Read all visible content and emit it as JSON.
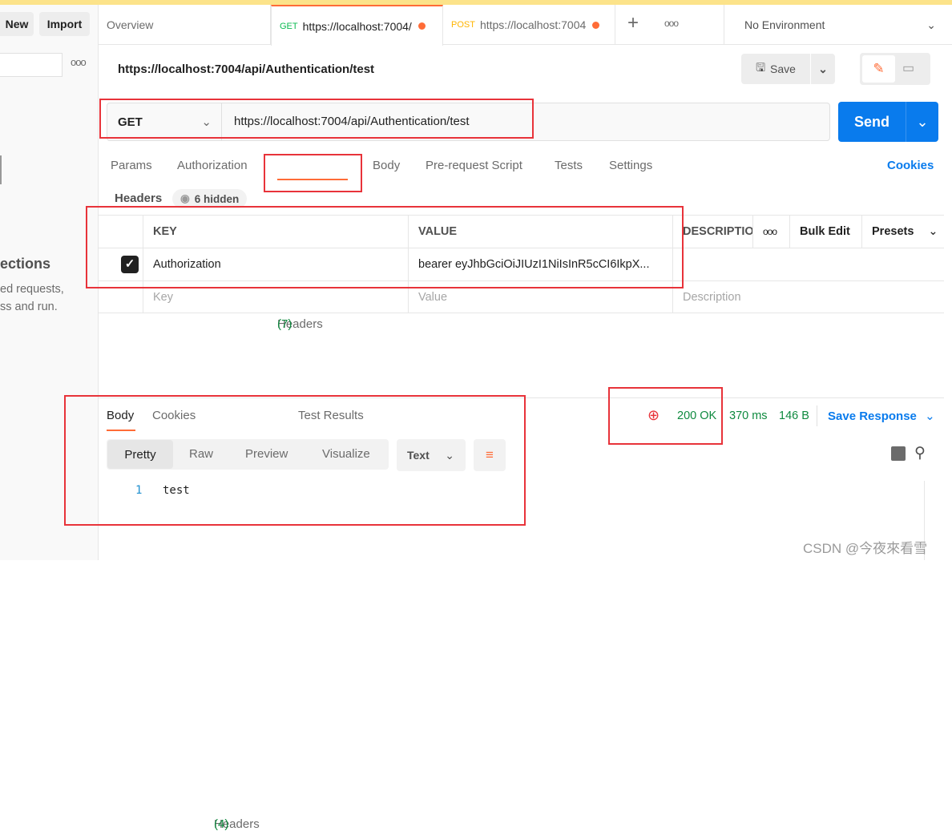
{
  "sidebar": {
    "new_label": "New",
    "import_label": "Import",
    "more_icon": "ellipsis-icon",
    "collections_heading": "ections",
    "collections_text_1": "ed requests,",
    "collections_text_2": "ss and run."
  },
  "tabs": [
    {
      "label": "Overview"
    },
    {
      "method": "GET",
      "label": "https://localhost:7004/",
      "method_color": "#0cbb52",
      "active": true,
      "unsaved": true
    },
    {
      "method": "POST",
      "label": "https://localhost:7004",
      "method_color": "#ffb400",
      "unsaved": true
    }
  ],
  "environment": {
    "selected": "No Environment"
  },
  "request": {
    "title": "https://localhost:7004/api/Authentication/test",
    "save_label": "Save",
    "method": "GET",
    "url": "https://localhost:7004/api/Authentication/test",
    "send_label": "Send"
  },
  "request_tabs": {
    "params": "Params",
    "authorization": "Authorization",
    "headers": "Headers",
    "headers_count": "(7)",
    "body": "Body",
    "prerequest": "Pre-request Script",
    "tests": "Tests",
    "settings": "Settings",
    "cookies": "Cookies"
  },
  "headers": {
    "label": "Headers",
    "hidden": "6 hidden",
    "columns": {
      "key": "KEY",
      "value": "VALUE",
      "description": "DESCRIPTIO",
      "bulk_edit": "Bulk Edit",
      "presets": "Presets"
    },
    "rows": [
      {
        "checked": true,
        "key": "Authorization",
        "value": "bearer eyJhbGciOiJIUzI1NiIsInR5cCI6IkpX..."
      }
    ],
    "placeholder": {
      "key": "Key",
      "value": "Value",
      "description": "Description"
    }
  },
  "response": {
    "tabs": {
      "body": "Body",
      "cookies": "Cookies",
      "headers": "Headers",
      "headers_count": "(4)",
      "test_results": "Test Results"
    },
    "status": "200 OK",
    "time": "370 ms",
    "size": "146 B",
    "save_response": "Save Response",
    "view_modes": [
      "Pretty",
      "Raw",
      "Preview",
      "Visualize"
    ],
    "format": "Text",
    "lines": [
      {
        "n": "1",
        "text": "test"
      }
    ]
  },
  "watermark": "CSDN @今夜來看雪",
  "colors": {
    "accent": "#ff6c37",
    "send": "#097bed",
    "status": "#0f8a3f",
    "link": "#097bed",
    "annotation": "#e8333a"
  }
}
